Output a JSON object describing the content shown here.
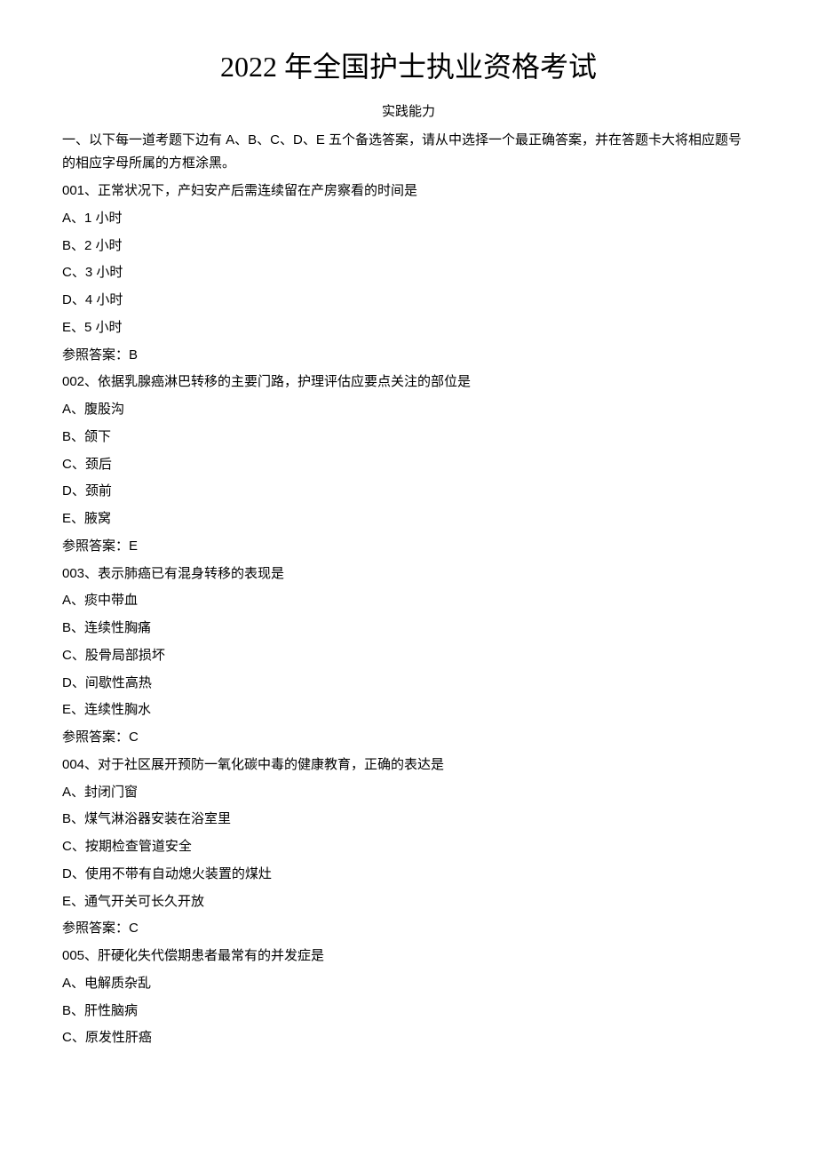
{
  "title": "2022 年全国护士执业资格考试",
  "subtitle": "实践能力",
  "instruction": "一、以下每一道考题下边有 A、B、C、D、E 五个备选答案，请从中选择一个最正确答案，并在答题卡大将相应题号的相应字母所属的方框涂黑。",
  "questions": [
    {
      "stem": "001、正常状况下，产妇安产后需连续留在产房察看的时间是",
      "options": [
        "A、1 小时",
        "B、2 小时",
        "C、3 小时",
        "D、4 小时",
        "E、5 小时"
      ],
      "answer": "参照答案：B"
    },
    {
      "stem": "002、依据乳腺癌淋巴转移的主要门路，护理评估应要点关注的部位是",
      "options": [
        "A、腹股沟",
        "B、颌下",
        "C、颈后",
        "D、颈前",
        "E、腋窝"
      ],
      "answer": "参照答案：E"
    },
    {
      "stem": "003、表示肺癌已有混身转移的表现是",
      "options": [
        "A、痰中带血",
        "B、连续性胸痛",
        "C、股骨局部损坏",
        "D、间歇性高热",
        "E、连续性胸水"
      ],
      "answer": "参照答案：C"
    },
    {
      "stem": "004、对于社区展开预防一氧化碳中毒的健康教育，正确的表达是",
      "options": [
        "A、封闭门窗",
        "B、煤气淋浴器安装在浴室里",
        "C、按期检查管道安全",
        "D、使用不带有自动熄火装置的煤灶",
        "E、通气开关可长久开放"
      ],
      "answer": "参照答案：C"
    },
    {
      "stem": "005、肝硬化失代偿期患者最常有的并发症是",
      "options": [
        "A、电解质杂乱",
        "B、肝性脑病",
        "C、原发性肝癌"
      ],
      "answer": ""
    }
  ]
}
